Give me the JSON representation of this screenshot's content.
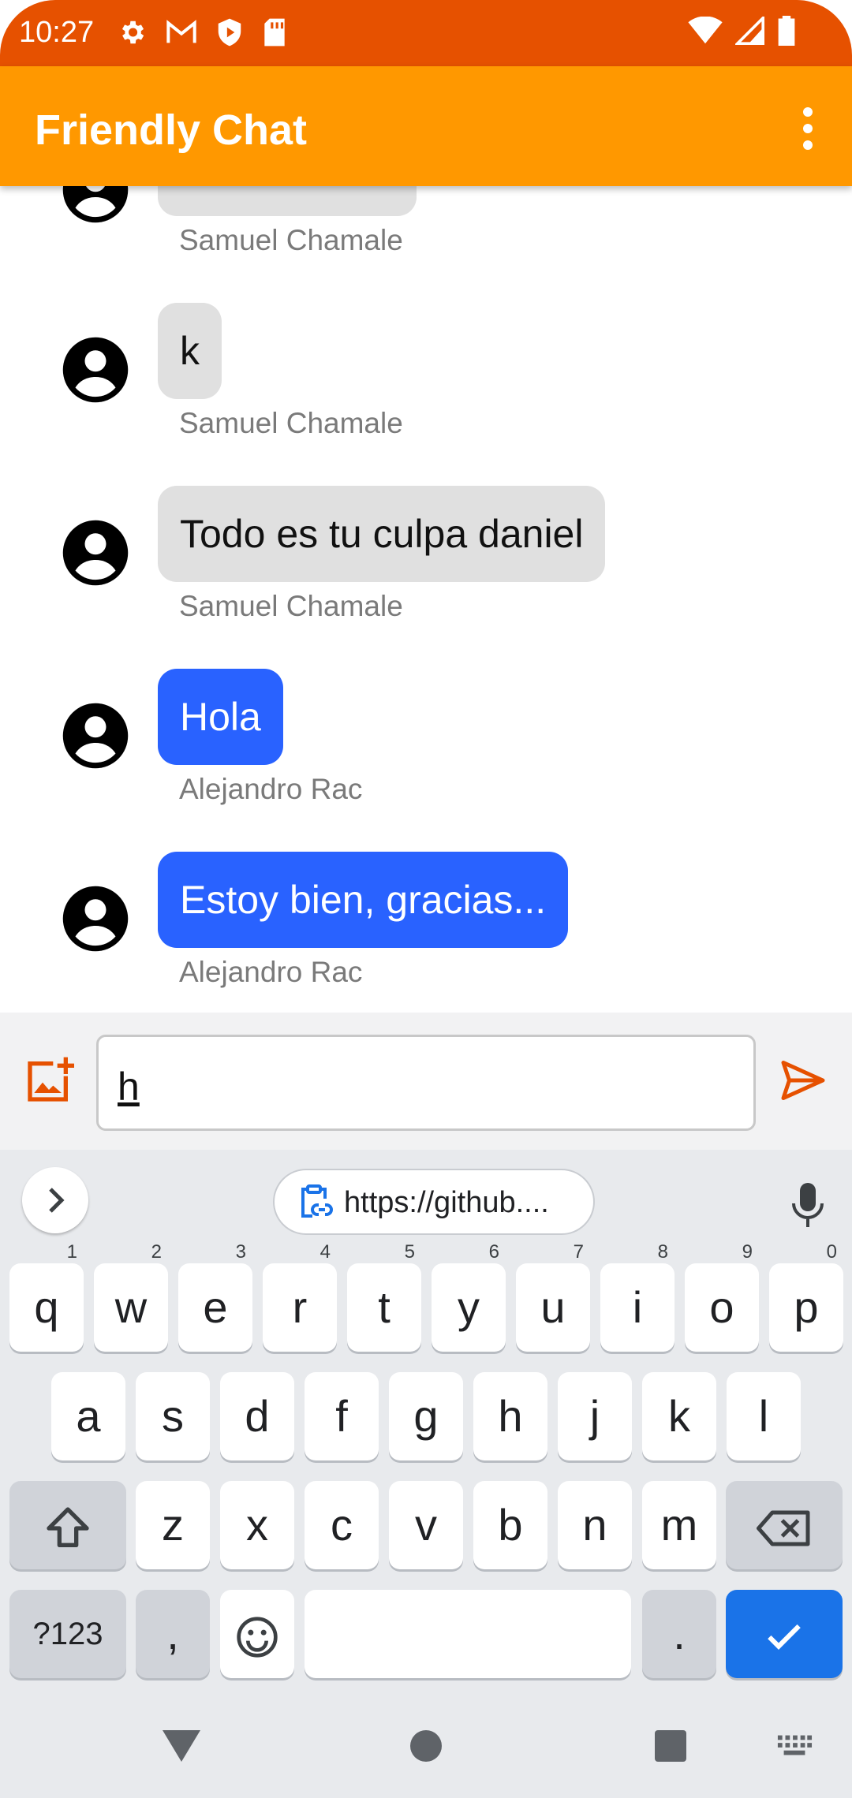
{
  "status_bar": {
    "time": "10:27",
    "left_icons": [
      "settings-icon",
      "gmail-icon",
      "shield-icon",
      "sd-card-icon"
    ],
    "right_icons": [
      "wifi-icon",
      "signal-icon",
      "battery-icon"
    ]
  },
  "app_bar": {
    "title": "Friendly Chat",
    "menu_icon": "more-vert-icon"
  },
  "messages": [
    {
      "text": "",
      "sender": "Samuel Chamale",
      "style": "gray"
    },
    {
      "text": "k",
      "sender": "Samuel Chamale",
      "style": "gray"
    },
    {
      "text": "Todo es tu culpa daniel",
      "sender": "Samuel Chamale",
      "style": "gray"
    },
    {
      "text": "Hola",
      "sender": "Alejandro Rac",
      "style": "blue"
    },
    {
      "text": "Estoy bien, gracias...",
      "sender": "Alejandro Rac",
      "style": "blue"
    }
  ],
  "composer": {
    "value": "h",
    "add_image_icon": "add-photo-icon",
    "send_icon": "send-icon"
  },
  "keyboard": {
    "suggestion_chip": "https://github....",
    "row1": [
      {
        "key": "q",
        "hint": "1"
      },
      {
        "key": "w",
        "hint": "2"
      },
      {
        "key": "e",
        "hint": "3"
      },
      {
        "key": "r",
        "hint": "4"
      },
      {
        "key": "t",
        "hint": "5"
      },
      {
        "key": "y",
        "hint": "6"
      },
      {
        "key": "u",
        "hint": "7"
      },
      {
        "key": "i",
        "hint": "8"
      },
      {
        "key": "o",
        "hint": "9"
      },
      {
        "key": "p",
        "hint": "0"
      }
    ],
    "row2": [
      "a",
      "s",
      "d",
      "f",
      "g",
      "h",
      "j",
      "k",
      "l"
    ],
    "row3": [
      "z",
      "x",
      "c",
      "v",
      "b",
      "n",
      "m"
    ],
    "symbols_label": "?123",
    "comma": ",",
    "period": "."
  },
  "colors": {
    "status_bar": "#e65100",
    "app_bar": "#ff9800",
    "bubble_gray": "#e0e0e0",
    "bubble_blue": "#2962ff",
    "accent": "#e65100",
    "enter_key": "#1a73e8"
  }
}
